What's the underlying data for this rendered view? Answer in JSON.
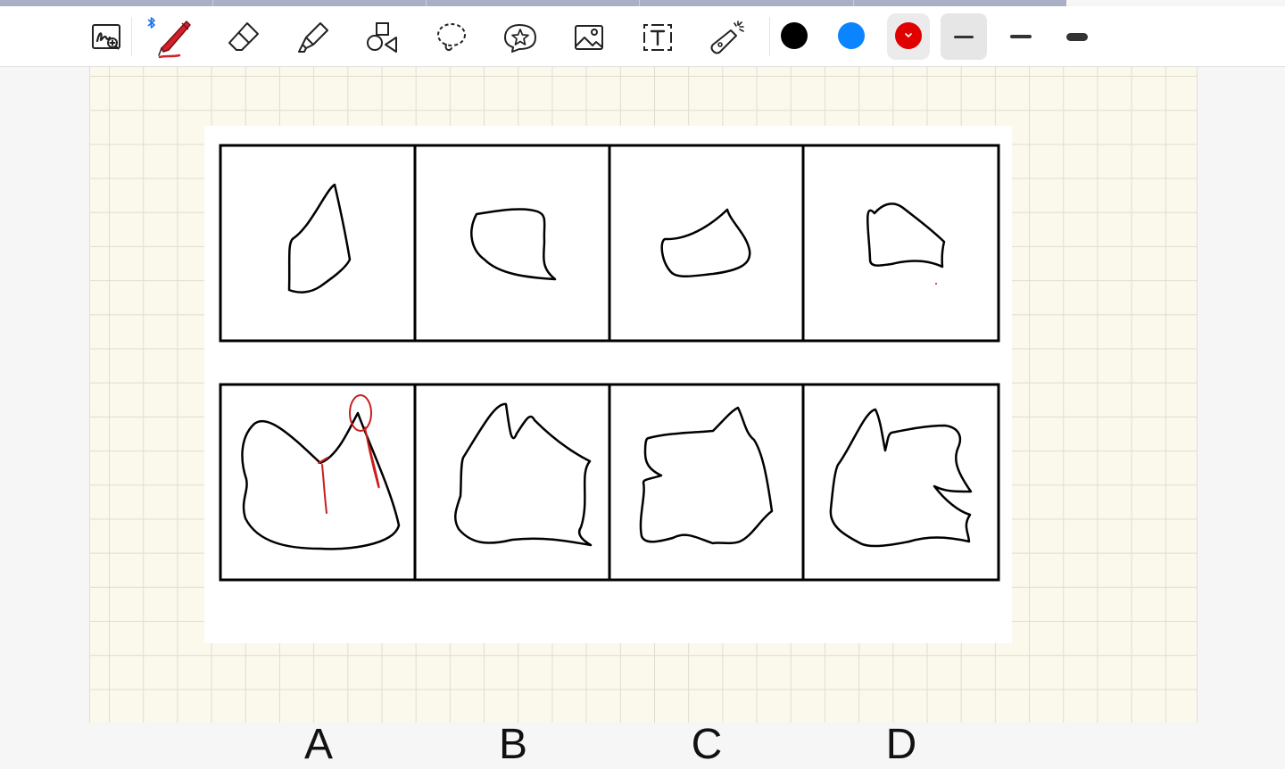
{
  "toolbar": {
    "tools": [
      {
        "name": "zoom-handwriting-tool",
        "icon": "handwriting-zoom-icon"
      },
      {
        "name": "pen-tool",
        "icon": "pen-icon",
        "selected": true,
        "color": "#d4202a"
      },
      {
        "name": "eraser-tool",
        "icon": "eraser-icon"
      },
      {
        "name": "highlighter-tool",
        "icon": "highlighter-icon"
      },
      {
        "name": "shapes-tool",
        "icon": "shapes-icon"
      },
      {
        "name": "lasso-tool",
        "icon": "lasso-icon"
      },
      {
        "name": "sticker-tool",
        "icon": "sticker-star-icon"
      },
      {
        "name": "image-tool",
        "icon": "image-icon"
      },
      {
        "name": "text-tool",
        "icon": "text-box-icon"
      },
      {
        "name": "laser-pointer-tool",
        "icon": "laser-pointer-icon"
      }
    ],
    "bluetooth_icon": "bluetooth-icon",
    "colors": [
      {
        "name": "black",
        "hex": "#000000"
      },
      {
        "name": "blue",
        "hex": "#0a84ff"
      },
      {
        "name": "red",
        "hex": "#e00000",
        "selected": true
      }
    ],
    "stroke_widths": [
      "thin",
      "medium",
      "thick"
    ],
    "selected_stroke": "thin"
  },
  "page": {
    "background": "#fbf9ec",
    "grid": true
  },
  "puzzle": {
    "option_labels": [
      "A",
      "B",
      "C",
      "D"
    ]
  },
  "annotation_color": "#c81e1e"
}
